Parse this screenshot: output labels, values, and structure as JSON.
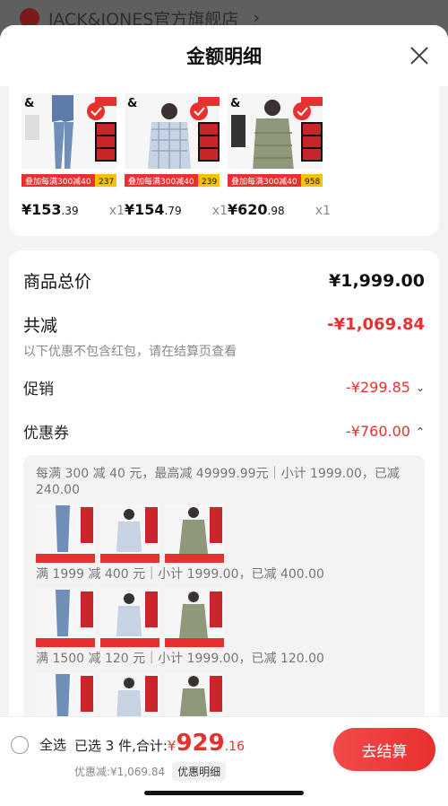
{
  "background": {
    "store_name": "JACK&JONES官方旗舰店",
    "chevron": "›"
  },
  "sheet": {
    "title": "金额明细"
  },
  "products": [
    {
      "price_int": "¥153",
      "price_dec": ".39",
      "qty": "x1",
      "badge_price": "237",
      "promo": "叠加每满300减40",
      "item": "jeans"
    },
    {
      "price_int": "¥154",
      "price_dec": ".79",
      "qty": "x1",
      "badge_price": "239",
      "promo": "叠加每满300减40",
      "item": "plaid-shirt"
    },
    {
      "price_int": "¥620",
      "price_dec": ".98",
      "qty": "x1",
      "badge_price": "958",
      "promo": "叠加每满300减40",
      "item": "down-jacket"
    }
  ],
  "summary": {
    "total_label": "商品总价",
    "total_value": "¥1,999.00",
    "reduce_label": "共减",
    "reduce_value": "-¥1,069.84",
    "reduce_note": "以下优惠不包含红包，请在结算页查看",
    "promo_label": "促销",
    "promo_value": "-¥299.85",
    "coupon_label": "优惠券",
    "coupon_value": "-¥760.00"
  },
  "coupons": [
    {
      "rule": "每满 300 减 40 元，最高减 49999.99元｜小计 1999.00，已减 240.00"
    },
    {
      "rule": "满 1999 减 400 元｜小计 1999.00，已减 400.00"
    },
    {
      "rule": "满 1500 减 120 元｜小计 1999.00，已减 120.00"
    }
  ],
  "bottom": {
    "select_all": "全选",
    "selected_label": "已选 3 件,合计:",
    "currency": "¥",
    "total_int": "929",
    "total_dec": ".16",
    "discount_text": "优惠减:¥1,069.84",
    "detail_tag": "优惠明细",
    "checkout": "去结算"
  },
  "colors": {
    "accent": "#e8312f",
    "background": "#f3f3f3"
  }
}
